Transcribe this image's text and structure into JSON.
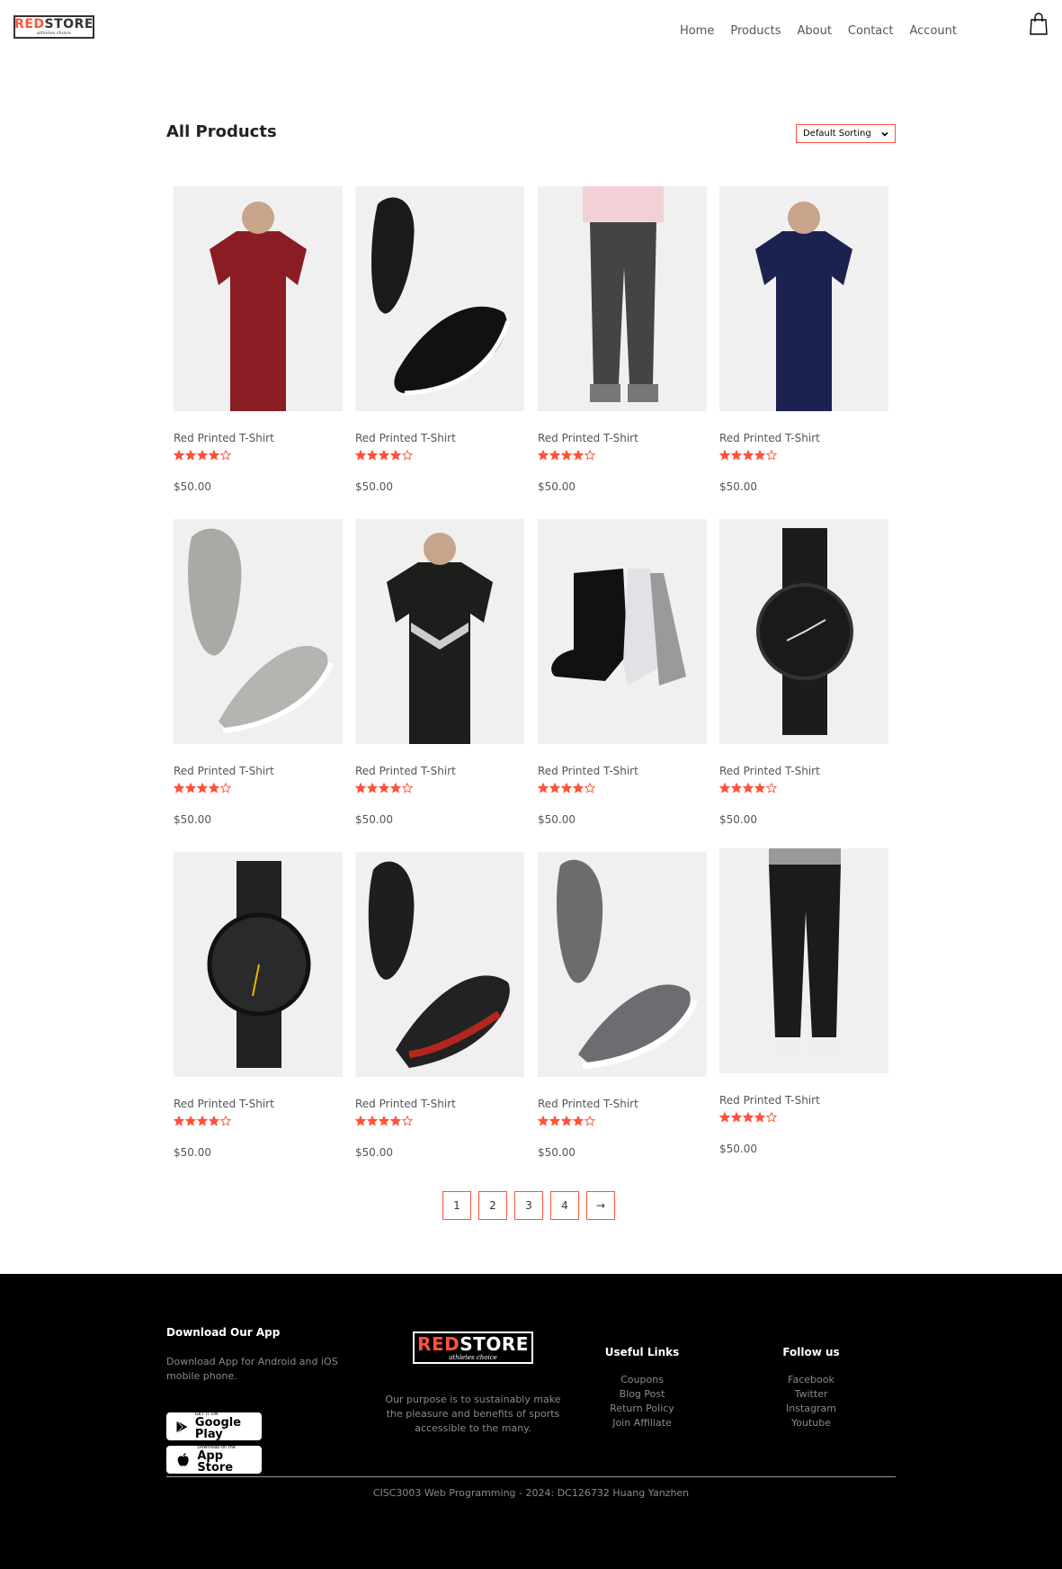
{
  "brand": {
    "name_red": "RED",
    "name_dark": "STORE",
    "tagline": "athletes choice"
  },
  "nav": {
    "items": [
      "Home",
      "Products",
      "About",
      "Contact",
      "Account"
    ]
  },
  "page": {
    "title": "All Products",
    "sort_selected": "Default Sorting"
  },
  "products": [
    {
      "name": "Red Printed T-Shirt",
      "price": "$50.00",
      "rating": 4,
      "image": "maroon-tshirt-image"
    },
    {
      "name": "Red Printed T-Shirt",
      "price": "$50.00",
      "rating": 4,
      "image": "black-sneakers-image"
    },
    {
      "name": "Red Printed T-Shirt",
      "price": "$50.00",
      "rating": 4,
      "image": "grey-trackpants-image"
    },
    {
      "name": "Red Printed T-Shirt",
      "price": "$50.00",
      "rating": 4,
      "image": "navy-polo-image"
    },
    {
      "name": "Red Printed T-Shirt",
      "price": "$50.00",
      "rating": 4,
      "image": "grey-hightop-shoes-image"
    },
    {
      "name": "Red Printed T-Shirt",
      "price": "$50.00",
      "rating": 4,
      "image": "black-puma-tshirt-image"
    },
    {
      "name": "Red Printed T-Shirt",
      "price": "$50.00",
      "rating": 4,
      "image": "socks-image"
    },
    {
      "name": "Red Printed T-Shirt",
      "price": "$50.00",
      "rating": 4,
      "image": "black-metal-watch-image"
    },
    {
      "name": "Red Printed T-Shirt",
      "price": "$50.00",
      "rating": 4,
      "image": "black-leather-watch-image"
    },
    {
      "name": "Red Printed T-Shirt",
      "price": "$50.00",
      "rating": 4,
      "image": "black-red-sneakers-image"
    },
    {
      "name": "Red Printed T-Shirt",
      "price": "$50.00",
      "rating": 4,
      "image": "grey-slipon-shoes-image"
    },
    {
      "name": "Red Printed T-Shirt",
      "price": "$50.00",
      "rating": 4,
      "image": "black-joggers-image"
    }
  ],
  "pagination": [
    "1",
    "2",
    "3",
    "4",
    "→"
  ],
  "footer": {
    "app_title": "Download Our App",
    "app_text": "Download App for Android and iOS mobile phone.",
    "google_play_small": "GET IT ON",
    "google_play_big": "Google Play",
    "app_store_small": "Download on the",
    "app_store_big": "App Store",
    "purpose": "Our purpose is to sustainably make the pleasure and benefits of sports accessible to the many.",
    "links_title": "Useful Links",
    "links": [
      "Coupons",
      "Blog Post",
      "Return Policy",
      "Join Affiliate"
    ],
    "follow_title": "Follow us",
    "follow": [
      "Facebook",
      "Twitter",
      "Instagram",
      "Youtube"
    ],
    "copyright": "CISC3003 Web Programming - 2024: DC126732 Huang Yanzhen"
  },
  "colors": {
    "accent": "#ff523b",
    "card_bg": "#f0f0f0",
    "footer_bg": "#000000"
  }
}
